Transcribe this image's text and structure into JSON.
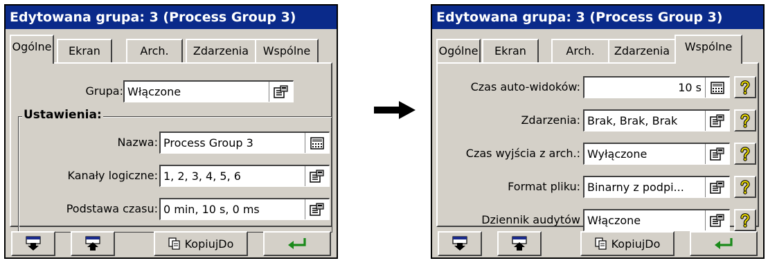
{
  "left": {
    "title": "Edytowana grupa: 3 (Process Group 3)",
    "tabs": [
      "Ogólne",
      "Ekran",
      "Arch.",
      "Zdarzenia",
      "Wspólne"
    ],
    "active_tab": "Ogólne",
    "grupa": {
      "label": "Grupa:",
      "value": "Włączone"
    },
    "group_title": "Ustawienia:",
    "fields": [
      {
        "label": "Nazwa:",
        "value": "Process Group 3",
        "icon": "keyboard-icon"
      },
      {
        "label": "Kanały logiczne:",
        "value": "1, 2, 3, 4, 5, 6",
        "icon": "list-picker-icon"
      },
      {
        "label": "Podstawa czasu:",
        "value": "0 min, 10 s, 0 ms",
        "icon": "list-picker-icon"
      }
    ],
    "bottom": {
      "copy_label": "KopiujDo"
    }
  },
  "right": {
    "title": "Edytowana grupa: 3 (Process Group 3)",
    "tabs": [
      "Ogólne",
      "Ekran",
      "Arch.",
      "Zdarzenia",
      "Wspólne"
    ],
    "active_tab": "Wspólne",
    "fields": [
      {
        "label": "Czas auto-widoków:",
        "value": "10 s",
        "icon": "keyboard-icon"
      },
      {
        "label": "Zdarzenia:",
        "value": "Brak, Brak, Brak",
        "icon": "list-picker-icon"
      },
      {
        "label": "Czas wyjścia z arch.:",
        "value": "Wyłączone",
        "icon": "list-picker-icon"
      },
      {
        "label": "Format pliku:",
        "value": "Binarny z podpi...",
        "icon": "list-picker-icon"
      },
      {
        "label": "Dziennik audytów",
        "value": "Włączone",
        "icon": "list-picker-icon"
      }
    ],
    "bottom": {
      "copy_label": "KopiujDo"
    }
  },
  "colors": {
    "titlebar": "#0a2a8a",
    "panel": "#d4d0c8",
    "enter_arrow": "#1a8a1a",
    "help_icon": "#e8d800"
  }
}
